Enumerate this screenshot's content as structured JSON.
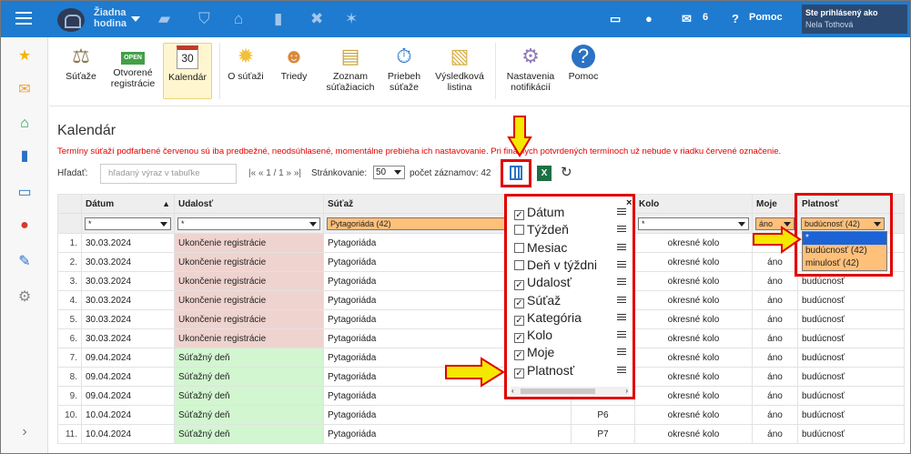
{
  "topbar": {
    "hodina": "Žiadna\nhodina",
    "messages_count": "6",
    "help": "Pomoc",
    "user_status": "Ste prihlásený ako",
    "user_name": "Nela Tothová"
  },
  "ribbon": [
    {
      "label": "Súťaže"
    },
    {
      "label": "Otvorené registrácie"
    },
    {
      "label": "Kalendár",
      "active": true
    },
    {
      "label": "O súťaži"
    },
    {
      "label": "Triedy"
    },
    {
      "label": "Zoznam súťažiacich"
    },
    {
      "label": "Priebeh súťaže"
    },
    {
      "label": "Výsledková listina"
    },
    {
      "label": "Nastavenia notifikácií"
    },
    {
      "label": "Pomoc"
    }
  ],
  "open_badge": "OPEN",
  "calendar_day": "30",
  "page": {
    "title": "Kalendár",
    "notice": "Termíny súťaží podfarbené červenou sú iba predbežné, neodsúhlasené, momentálne prebieha ich nastavovanie. Pri finálnych potvrdených termínoch už nebude v riadku červené označenie."
  },
  "filter": {
    "search_label": "Hľadať:",
    "search_placeholder": "hľadaný výraz v tabuľke",
    "pager": "|« « 1 / 1 » »|",
    "page_size_label": "Stránkovanie:",
    "page_size": "50",
    "count_label": "počet záznamov: 42"
  },
  "table": {
    "headers": [
      "",
      "Dátum",
      "Udalosť",
      "Súťaž",
      "",
      "Kolo",
      "Moje",
      "Platnosť"
    ],
    "filters": {
      "datum": "*",
      "udalost": "*",
      "sutaz": "Pytagoriáda (42)",
      "kolo": "*",
      "moje": "áno",
      "platnost": "budúcnosť (42)"
    },
    "rows": [
      {
        "n": "1.",
        "date": "30.03.2024",
        "event": "Ukončenie registrácie",
        "type": "reg",
        "comp": "Pytagoriáda",
        "cat": "",
        "round": "okresné kolo",
        "mine": "áno",
        "valid": "budúcnosť"
      },
      {
        "n": "2.",
        "date": "30.03.2024",
        "event": "Ukončenie registrácie",
        "type": "reg",
        "comp": "Pytagoriáda",
        "cat": "",
        "round": "okresné kolo",
        "mine": "áno",
        "valid": "budúcnosť"
      },
      {
        "n": "3.",
        "date": "30.03.2024",
        "event": "Ukončenie registrácie",
        "type": "reg",
        "comp": "Pytagoriáda",
        "cat": "",
        "round": "okresné kolo",
        "mine": "áno",
        "valid": "budúcnosť"
      },
      {
        "n": "4.",
        "date": "30.03.2024",
        "event": "Ukončenie registrácie",
        "type": "reg",
        "comp": "Pytagoriáda",
        "cat": "",
        "round": "okresné kolo",
        "mine": "áno",
        "valid": "budúcnosť"
      },
      {
        "n": "5.",
        "date": "30.03.2024",
        "event": "Ukončenie registrácie",
        "type": "reg",
        "comp": "Pytagoriáda",
        "cat": "",
        "round": "okresné kolo",
        "mine": "áno",
        "valid": "budúcnosť"
      },
      {
        "n": "6.",
        "date": "30.03.2024",
        "event": "Ukončenie registrácie",
        "type": "reg",
        "comp": "Pytagoriáda",
        "cat": "",
        "round": "okresné kolo",
        "mine": "áno",
        "valid": "budúcnosť"
      },
      {
        "n": "7.",
        "date": "09.04.2024",
        "event": "Súťažný deň",
        "type": "day",
        "comp": "Pytagoriáda",
        "cat": "",
        "round": "okresné kolo",
        "mine": "áno",
        "valid": "budúcnosť"
      },
      {
        "n": "8.",
        "date": "09.04.2024",
        "event": "Súťažný deň",
        "type": "day",
        "comp": "Pytagoriáda",
        "cat": "",
        "round": "okresné kolo",
        "mine": "áno",
        "valid": "budúcnosť"
      },
      {
        "n": "9.",
        "date": "09.04.2024",
        "event": "Súťažný deň",
        "type": "day",
        "comp": "Pytagoriáda",
        "cat": "P5",
        "round": "okresné kolo",
        "mine": "áno",
        "valid": "budúcnosť"
      },
      {
        "n": "10.",
        "date": "10.04.2024",
        "event": "Súťažný deň",
        "type": "day",
        "comp": "Pytagoriáda",
        "cat": "P6",
        "round": "okresné kolo",
        "mine": "áno",
        "valid": "budúcnosť"
      },
      {
        "n": "11.",
        "date": "10.04.2024",
        "event": "Súťažný deň",
        "type": "day",
        "comp": "Pytagoriáda",
        "cat": "P7",
        "round": "okresné kolo",
        "mine": "áno",
        "valid": "budúcnosť"
      }
    ]
  },
  "column_popup": {
    "close": "×",
    "items": [
      {
        "label": "Dátum",
        "checked": true
      },
      {
        "label": "Týždeň",
        "checked": false
      },
      {
        "label": "Mesiac",
        "checked": false
      },
      {
        "label": "Deň v týždni",
        "checked": false
      },
      {
        "label": "Udalosť",
        "checked": true
      },
      {
        "label": "Súťaž",
        "checked": true
      },
      {
        "label": "Kategória",
        "checked": true
      },
      {
        "label": "Kolo",
        "checked": true
      },
      {
        "label": "Moje",
        "checked": true
      },
      {
        "label": "Platnosť",
        "checked": true
      }
    ]
  },
  "platnost_dropdown": [
    "*",
    "budúcnosť (42)",
    "minulosť (42)"
  ],
  "colors": {
    "topbar": "#1e7bd0",
    "highlight_red": "#e00000",
    "arrow_yellow": "#f5e800",
    "reg_row": "#efd3cf",
    "day_row": "#d2f6d0",
    "filter_orange": "#ffc07a"
  }
}
